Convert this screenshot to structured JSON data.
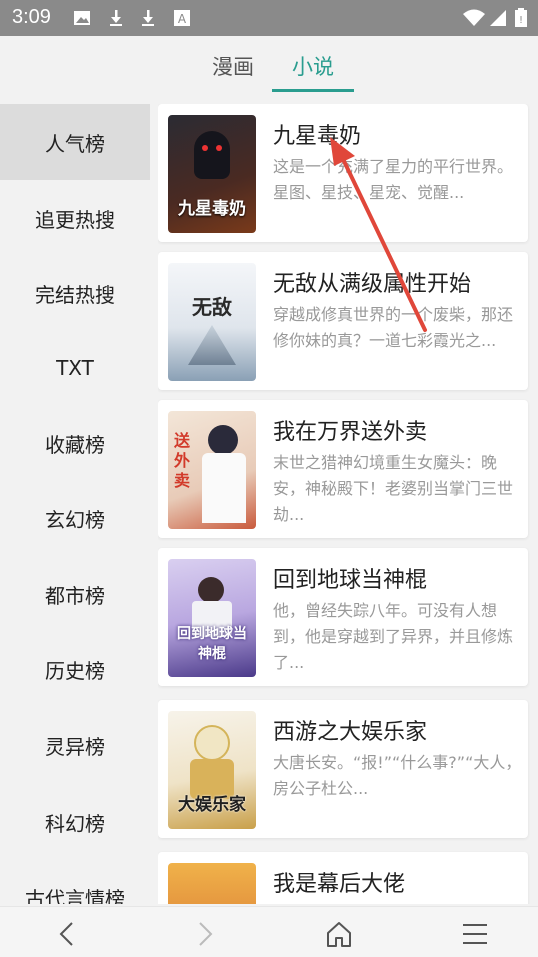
{
  "status_bar": {
    "time": "3:09",
    "icons": [
      "image-icon",
      "download-icon",
      "download-icon",
      "a-icon"
    ],
    "right_icons": [
      "wifi-icon",
      "signal-icon",
      "battery-icon"
    ]
  },
  "tabs": [
    {
      "label": "漫画",
      "active": false
    },
    {
      "label": "小说",
      "active": true
    }
  ],
  "sidebar": {
    "items": [
      {
        "label": "人气榜",
        "active": true
      },
      {
        "label": "追更热搜"
      },
      {
        "label": "完结热搜"
      },
      {
        "label": "TXT"
      },
      {
        "label": "收藏榜"
      },
      {
        "label": "玄幻榜"
      },
      {
        "label": "都市榜"
      },
      {
        "label": "历史榜"
      },
      {
        "label": "灵异榜"
      },
      {
        "label": "科幻榜"
      },
      {
        "label": "古代言情榜"
      }
    ]
  },
  "books": [
    {
      "title": "九星毒奶",
      "desc": "这是一个充满了星力的平行世界。星图、星技、星宠、觉醒...",
      "cover_text": "九星毒奶",
      "cover_colors": [
        "#2b2b33",
        "#7a3a1a"
      ]
    },
    {
      "title": "无敌从满级属性开始",
      "desc": "穿越成修真世界的一个废柴，那还修你妹的真？一道七彩霞光之...",
      "cover_text": "无敌",
      "cover_colors": [
        "#e9edf2",
        "#8aa0b5"
      ]
    },
    {
      "title": "我在万界送外卖",
      "desc": "末世之猎神幻境重生女魔头：晚安，神秘殿下！老婆别当掌门三世劫...",
      "cover_text": "送外卖",
      "cover_colors": [
        "#f3e6d8",
        "#c95a3c"
      ]
    },
    {
      "title": "回到地球当神棍",
      "desc": "他，曾经失踪八年。可没有人想到，他是穿越到了异界，并且修炼了...",
      "cover_text": "回到地球当神棍",
      "cover_colors": [
        "#b9a7e0",
        "#4b3a8a"
      ]
    },
    {
      "title": "西游之大娱乐家",
      "desc": "大唐长安。“报!”“什么事?”“大人，房公子杜公...",
      "cover_text": "大娱乐家",
      "cover_colors": [
        "#f4efe4",
        "#c9a04a"
      ]
    },
    {
      "title": "我是幕后大佬",
      "desc": "",
      "cover_text": "",
      "cover_colors": [
        "#f0b24a",
        "#d8562a"
      ]
    }
  ],
  "nav_bar": {
    "items": [
      "back-icon",
      "forward-icon",
      "home-icon",
      "menu-icon"
    ]
  },
  "colors": {
    "accent": "#2a9d8f",
    "annotation": "#e0473a"
  }
}
